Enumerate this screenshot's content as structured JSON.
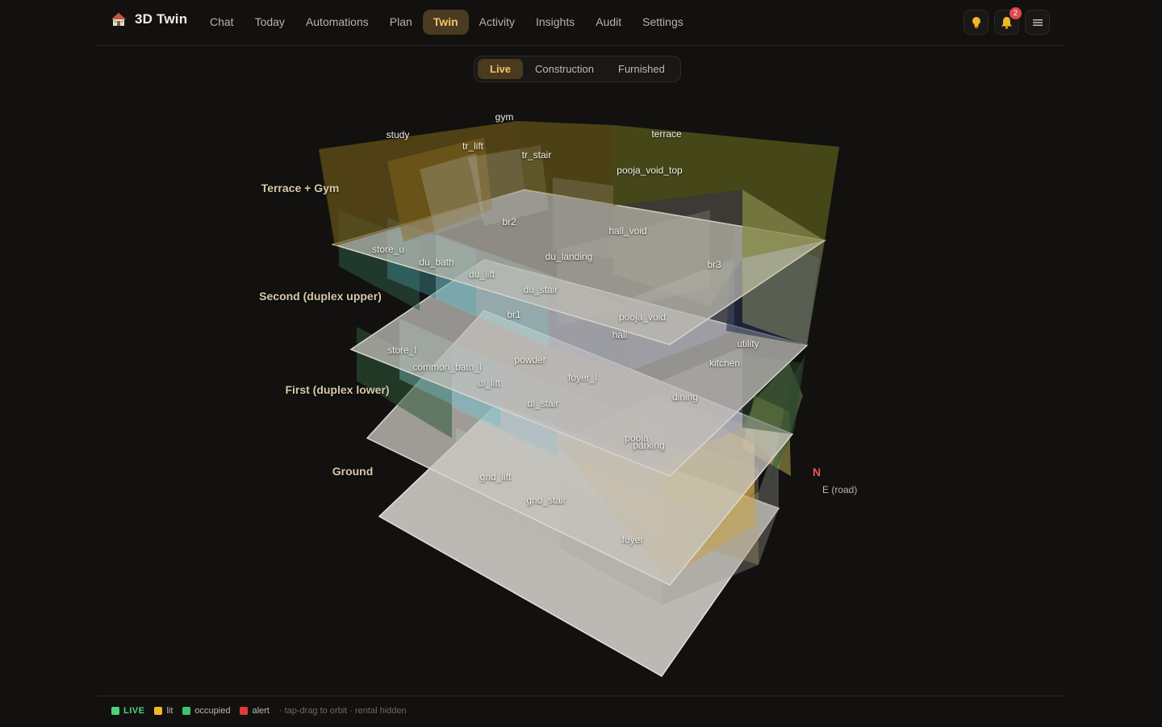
{
  "app": {
    "title": "3D Twin",
    "logo_icon": "house-icon"
  },
  "nav": {
    "items": [
      {
        "label": "Chat"
      },
      {
        "label": "Today"
      },
      {
        "label": "Automations"
      },
      {
        "label": "Plan"
      },
      {
        "label": "Twin",
        "active": true
      },
      {
        "label": "Activity"
      },
      {
        "label": "Insights"
      },
      {
        "label": "Audit"
      },
      {
        "label": "Settings"
      }
    ]
  },
  "header_actions": {
    "ideas_icon": "lightbulb-icon",
    "notifications_icon": "bell-icon",
    "notifications_count": "2",
    "menu_icon": "hamburger-menu-icon"
  },
  "modes": {
    "items": [
      {
        "label": "Live",
        "active": true
      },
      {
        "label": "Construction"
      },
      {
        "label": "Furnished"
      }
    ]
  },
  "floors": {
    "terrace": "Terrace + Gym",
    "second": "Second (duplex upper)",
    "first": "First (duplex lower)",
    "ground": "Ground"
  },
  "rooms": {
    "terrace": [
      "gym",
      "study",
      "tr_lift",
      "tr_stair",
      "terrace",
      "pooja_void_top"
    ],
    "second": [
      "br2",
      "hall_void",
      "store_u",
      "du_bath",
      "du_landing",
      "du_lift",
      "br3",
      "du_stair",
      "pooja_void"
    ],
    "first": [
      "br1",
      "hall",
      "utility",
      "store_l",
      "powder",
      "kitchen",
      "common_bath_l",
      "foyer_l",
      "dl_lift",
      "dining",
      "dl_stair"
    ],
    "ground": [
      "pooja",
      "parking",
      "gnd_lift",
      "gnd_stair",
      "foyer"
    ]
  },
  "compass": {
    "north": "N",
    "east": "E (road)"
  },
  "status": {
    "live": "LIVE",
    "lit": "lit",
    "occupied": "occupied",
    "alert": "alert",
    "hint": "· tap-drag to orbit · rental hidden"
  },
  "colors": {
    "accent": "#f3c46b",
    "live": "#4fd17a",
    "lit": "#f2b62a",
    "occupied": "#3dc46b",
    "alert": "#e03b3b",
    "background": "#121110"
  }
}
